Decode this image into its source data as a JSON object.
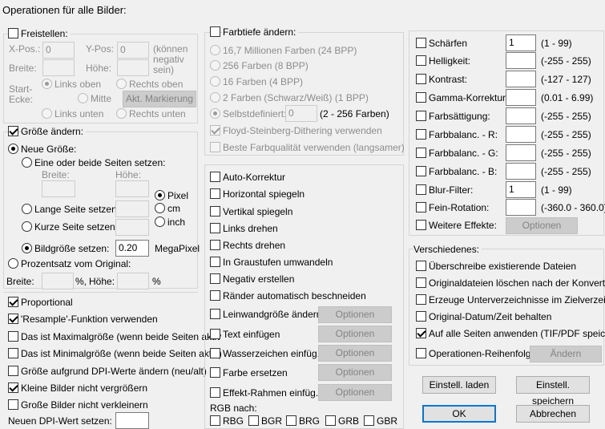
{
  "window": {
    "title": "Operationen für alle Bilder:"
  },
  "crop": {
    "label": "Freistellen:",
    "xpos_label": "X-Pos.:",
    "xpos_value": "0",
    "ypos_label": "Y-Pos:",
    "ypos_value": "0",
    "note": [
      "(können",
      "negativ",
      "sein)"
    ],
    "width_label": "Breite:",
    "height_label": "Höhe:",
    "start_label": "Start-",
    "corner_label": "Ecke:",
    "top_left": "Links oben",
    "top_right": "Rechts oben",
    "center": "Mitte",
    "bottom_left": "Links unten",
    "bottom_right": "Rechts unten",
    "mark_button": "Akt. Markierung"
  },
  "resize": {
    "label": "Größe ändern:",
    "new_size": "Neue Größe:",
    "one_or_both": "Eine oder beide Seiten setzen:",
    "width_label": "Breite:",
    "height_label": "Höhe:",
    "long_side": "Lange Seite setzen:",
    "short_side": "Kurze Seite setzen:",
    "unit_pixel": "Pixel",
    "unit_cm": "cm",
    "unit_inch": "inch",
    "image_size": "Bildgröße setzen:",
    "image_size_value": "0.20",
    "megapixel": "MegaPixel",
    "percent": "Prozentsatz vom Original:",
    "percent_width": "Breite:",
    "percent_sign1": "%,",
    "percent_height": "Höhe:",
    "percent_sign2": "%",
    "proportional": "Proportional",
    "resample": "'Resample'-Funktion verwenden",
    "max_size": "Das ist Maximalgröße (wenn beide Seiten aktiv",
    "min_size": "Das ist Minimalgröße (wenn beide Seiten aktiv)",
    "dpi_resize": "Größe aufgrund DPI-Werte ändern (neu/alt)",
    "no_enlarge": "Kleine Bilder nicht vergrößern",
    "no_shrink": "Große Bilder nicht verkleinern",
    "dpi_label": "Neuen DPI-Wert setzen:"
  },
  "color_depth": {
    "label": "Farbtiefe ändern:",
    "opt_24": "16,7 Millionen Farben (24 BPP)",
    "opt_8": "256 Farben (8 BPP)",
    "opt_4": "16 Farben (4 BPP)",
    "opt_1": "2 Farben (Schwarz/Weiß) (1 BPP)",
    "custom": "Selbstdefiniert:",
    "custom_value": "0",
    "custom_range": "(2 - 256 Farben)",
    "dithering": "Floyd-Steinberg-Dithering verwenden",
    "best_quality": "Beste Farbqualität verwenden (langsamer)"
  },
  "operations": {
    "auto": "Auto-Korrektur",
    "flip_h": "Horizontal spiegeln",
    "flip_v": "Vertikal spiegeln",
    "rot_left": "Links drehen",
    "rot_right": "Rechts drehen",
    "gray": "In Graustufen umwandeln",
    "negative": "Negativ erstellen",
    "autocrop": "Ränder automatisch beschneiden",
    "canvas": "Leinwandgröße ändern",
    "text": "Text einfügen",
    "watermark": "Wasserzeichen einfüg.",
    "replace_color": "Farbe ersetzen",
    "frame": "Effekt-Rahmen einfüg.",
    "options": "Optionen",
    "rgb_label": "RGB nach:",
    "rgb": [
      "RBG",
      "BGR",
      "BRG",
      "GRB",
      "GBR"
    ]
  },
  "adjust": {
    "sharpen": "Schärfen",
    "sharpen_value": "1",
    "sharpen_range": "(1  -  99)",
    "brightness": "Helligkeit:",
    "brightness_range": "(-255  -  255)",
    "contrast": "Kontrast:",
    "contrast_range": "(-127  -  127)",
    "gamma": "Gamma-Korrektur:",
    "gamma_range": "(0.01  -  6.99)",
    "saturation": "Farbsättigung:",
    "saturation_range": "(-255  -  255)",
    "bal_r": "Farbbalanc. - R:",
    "bal_r_range": "(-255  -  255)",
    "bal_g": "Farbbalanc. - G:",
    "bal_g_range": "(-255  -  255)",
    "bal_b": "Farbbalanc. - B:",
    "bal_b_range": "(-255  -  255)",
    "blur": "Blur-Filter:",
    "blur_value": "1",
    "blur_range": "(1  -  99)",
    "fine_rot": "Fein-Rotation:",
    "fine_rot_range": "(-360.0  -  360.0)",
    "more": "Weitere Effekte:",
    "options": "Optionen"
  },
  "misc": {
    "label": "Verschiedenes:",
    "overwrite": "Überschreibe existierende Dateien",
    "delete": "Originaldateien löschen nach der Konvertier.",
    "subdirs": "Erzeuge Unterverzeichnisse im Zielverzeichn.",
    "keep_date": "Original-Datum/Zeit behalten",
    "all_pages": "Auf alle Seiten anwenden (TIF/PDF speichern)",
    "order": "Operationen-Reihenfolge",
    "change": "Ändern"
  },
  "buttons": {
    "load": "Einstell. laden",
    "save": "Einstell. speichern",
    "ok": "OK",
    "cancel": "Abbrechen"
  }
}
